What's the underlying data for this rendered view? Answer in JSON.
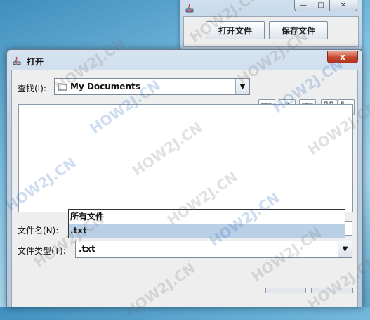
{
  "parent_window": {
    "open_button": "打开文件",
    "save_button": "保存文件"
  },
  "dialog": {
    "title": "打开",
    "close_glyph": "x",
    "look_in_label": "查找(I):",
    "look_in_value": "My Documents",
    "filename_label": "文件名(N):",
    "filename_value": "",
    "filetype_label": "文件类型(T):",
    "filetype_value": ".txt",
    "filetype_options": [
      "所有文件",
      ".txt"
    ],
    "selected_option_index": 1
  },
  "watermark_text": "HOW2J.CN",
  "colors": {
    "close_button": "#c8462d",
    "selected_option": "#b8cfe5"
  }
}
